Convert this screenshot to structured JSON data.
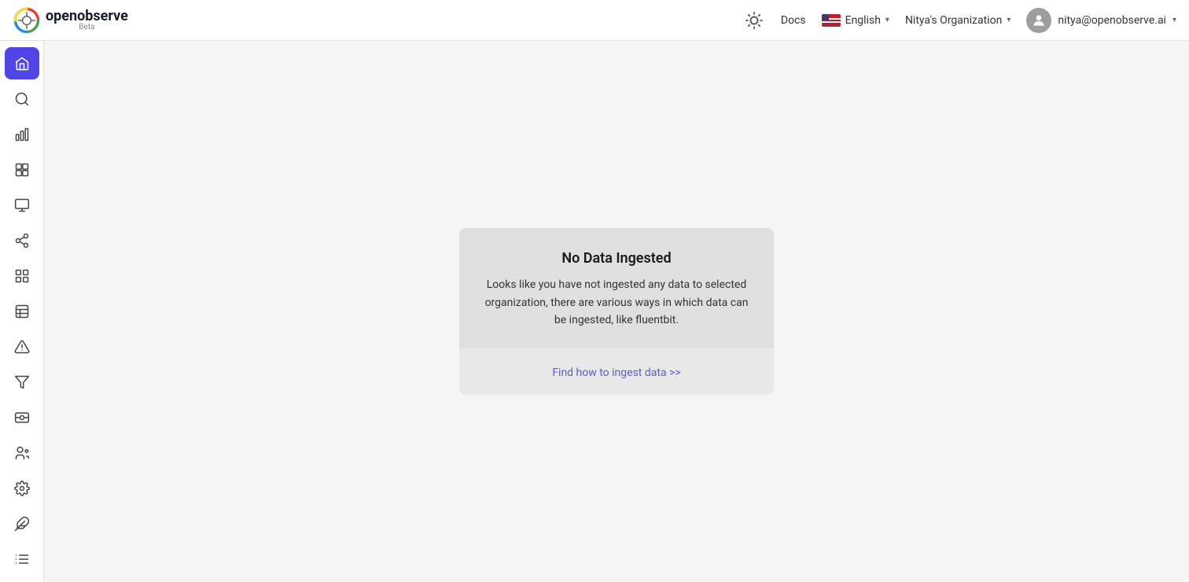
{
  "header": {
    "logo_name": "openobserve",
    "logo_beta": "Beta",
    "docs_label": "Docs",
    "lang": {
      "label": "English"
    },
    "org": {
      "label": "Nitya's Organization"
    },
    "user": {
      "email": "nitya@openobserve.ai"
    }
  },
  "sidebar": {
    "items": [
      {
        "name": "home",
        "tooltip": "Home"
      },
      {
        "name": "search",
        "tooltip": "Search"
      },
      {
        "name": "metrics",
        "tooltip": "Metrics"
      },
      {
        "name": "dashboard",
        "tooltip": "Dashboard"
      },
      {
        "name": "monitor",
        "tooltip": "Monitor"
      },
      {
        "name": "pipeline",
        "tooltip": "Pipeline"
      },
      {
        "name": "apps",
        "tooltip": "Apps"
      },
      {
        "name": "table",
        "tooltip": "Table"
      },
      {
        "name": "alerts",
        "tooltip": "Alerts"
      },
      {
        "name": "filter",
        "tooltip": "Filter"
      },
      {
        "name": "ingest",
        "tooltip": "Ingest"
      },
      {
        "name": "iam",
        "tooltip": "IAM"
      },
      {
        "name": "settings",
        "tooltip": "Settings"
      },
      {
        "name": "integrations",
        "tooltip": "Integrations"
      },
      {
        "name": "logs",
        "tooltip": "Logs"
      }
    ]
  },
  "main": {
    "card": {
      "title": "No Data Ingested",
      "description": "Looks like you have not ingested any data to selected organization, there are various ways in which data can be ingested, like fluentbit.",
      "link_label": "Find how to ingest data >>"
    }
  }
}
